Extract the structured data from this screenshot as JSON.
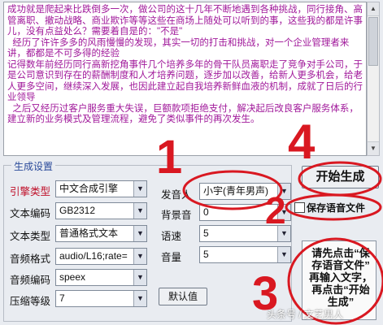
{
  "editor": {
    "text": "成功就是爬起来比跌倒多一次，做公司的这十几年不断地遇到各种挑战，同行接角、高管离职、撤动战略、商业欺诈等等这些在商场上随处可以听到的事，这些我的都是许事儿，没有点益处么？需要着自是的：\"不是\"\n  经历了许许多多的风雨慢慢的发现，其实一切的打击和挑战，对一个企业管理者来讲，都都是不可多得的经验\n记得数年前经历同行高新挖角事件几个培养多年的骨干队员离职走了竞争对手公司，于是公司意识到存在的薪酬制度和人才培养问题，逐步加以改善，给新人更多机会，给老人更多空间，继续深入发展，也因此建立起自我培养新鲜血液的机制，成就了日后的行业领导\n  之后又经历过客户服务重大失误，巨额款项拒绝支付，解决起后改良客户服务体系，建立新的业务模式及管理流程，避免了类似事件的再次发生。"
  },
  "settings": {
    "group_title": "生成设置",
    "engine_type": {
      "label": "引擎类型",
      "value": "中文合成引擎"
    },
    "text_encoding": {
      "label": "文本编码",
      "value": "GB2312"
    },
    "text_type": {
      "label": "文本类型",
      "value": "普通格式文本"
    },
    "audio_format": {
      "label": "音频格式",
      "value": "audio/L16;rate="
    },
    "audio_encoding": {
      "label": "音频编码",
      "value": "speex"
    },
    "compression": {
      "label": "压缩等级",
      "value": "7"
    },
    "voice": {
      "label": "发音人",
      "value": "小宇(青年男声)"
    },
    "bg_sound": {
      "label": "背景音",
      "value": "0"
    },
    "speed": {
      "label": "语速",
      "value": "5"
    },
    "volume": {
      "label": "音量",
      "value": "5"
    },
    "default_button": "默认值"
  },
  "actions": {
    "start_button": "开始生成",
    "save_checkbox": "保存语音文件",
    "save_checked": false
  },
  "tip": {
    "lines": [
      "请先点击“保",
      "存语音文件”",
      "再输入文字，",
      "再点击“开始",
      "生成”"
    ]
  },
  "annotations": {
    "n1": "1",
    "n2": "2",
    "n3": "3",
    "n4": "4",
    "color": "#d91821"
  },
  "watermark": "头条号 / 文艺男人"
}
